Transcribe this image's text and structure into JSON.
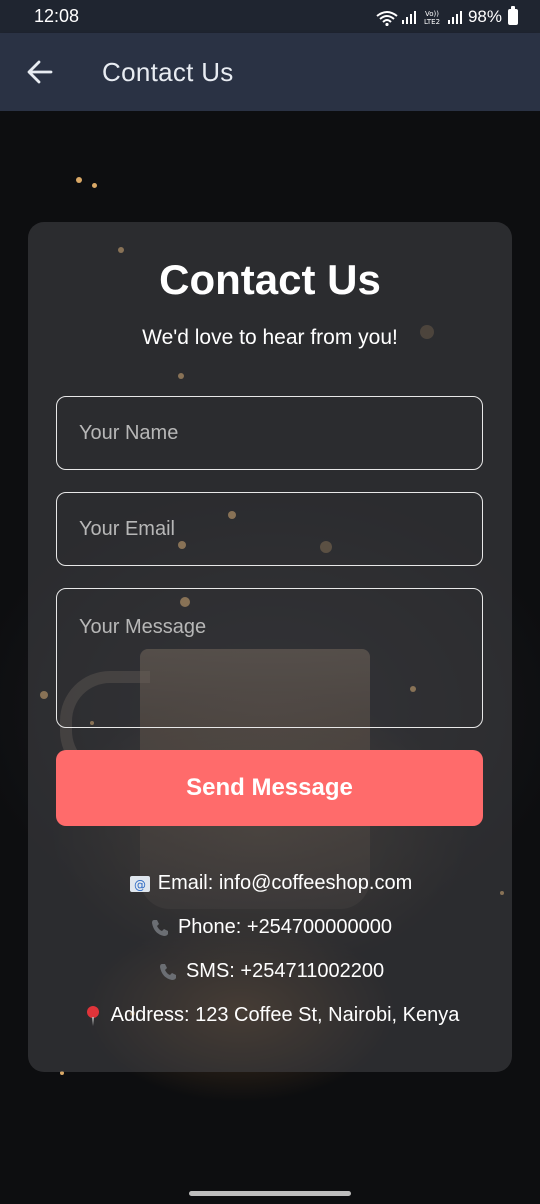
{
  "status_bar": {
    "time": "12:08",
    "battery": "98%",
    "lte_label": "Vo))\nLTE2"
  },
  "app_bar": {
    "back_icon": "arrow-left-icon",
    "title": "Contact Us"
  },
  "card": {
    "title": "Contact Us",
    "subtitle": "We'd love to hear from you!",
    "name_placeholder": "Your Name",
    "email_placeholder": "Your Email",
    "message_placeholder": "Your Message",
    "send_label": "Send Message"
  },
  "contact_info": {
    "email": "Email: info@coffeeshop.com",
    "phone": "Phone: +254700000000",
    "sms": "SMS: +254711002200",
    "address": "Address: 123 Coffee St, Nairobi, Kenya"
  },
  "colors": {
    "app_bar": "#2a3244",
    "status_bar": "#1f2530",
    "send_button": "#ff6b6b",
    "card": "rgba(70,70,72,0.55)"
  }
}
